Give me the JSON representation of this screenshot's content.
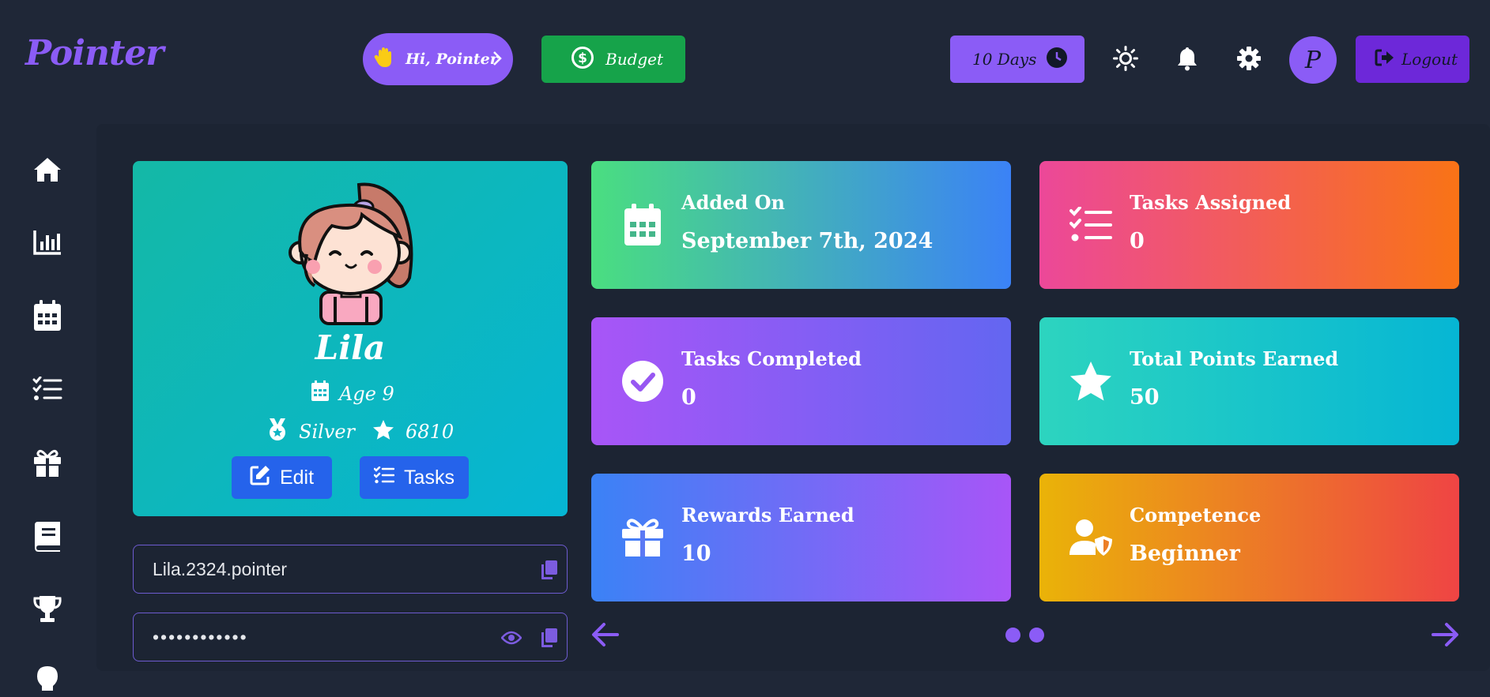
{
  "header": {
    "logo": "Pointer",
    "greeting": "Hi, Pointer",
    "budget": "Budget",
    "days": "10 Days",
    "avatar_letter": "P",
    "logout": "Logout"
  },
  "sidebar": {
    "items": [
      {
        "icon": "home-icon"
      },
      {
        "icon": "bar-chart-icon"
      },
      {
        "icon": "calendar-icon"
      },
      {
        "icon": "task-list-icon"
      },
      {
        "icon": "gift-icon"
      },
      {
        "icon": "book-icon"
      },
      {
        "icon": "trophy-icon"
      },
      {
        "icon": "lightbulb-icon"
      }
    ]
  },
  "profile": {
    "name": "Lila",
    "age": "Age 9",
    "rank": "Silver",
    "points": "6810",
    "edit": "Edit",
    "tasks": "Tasks",
    "username": "Lila.2324.pointer",
    "password": "••••••••••••"
  },
  "cards": [
    {
      "title": "Added On",
      "value": "September 7th, 2024",
      "icon": "calendar-icon"
    },
    {
      "title": "Tasks Assigned",
      "value": "0",
      "icon": "task-list-icon"
    },
    {
      "title": "Tasks Completed",
      "value": "0",
      "icon": "check-circle-icon"
    },
    {
      "title": "Total Points Earned",
      "value": "50",
      "icon": "star-icon"
    },
    {
      "title": "Rewards Earned",
      "value": "10",
      "icon": "gift-icon"
    },
    {
      "title": "Competence",
      "value": "Beginner",
      "icon": "user-shield-icon"
    }
  ],
  "colors": {
    "accent": "#8b5cf6",
    "budget": "#16a34a",
    "logout": "#6d28d9",
    "background": "#1f2737",
    "button_blue": "#2563eb"
  },
  "carousel": {
    "pages": 2
  }
}
